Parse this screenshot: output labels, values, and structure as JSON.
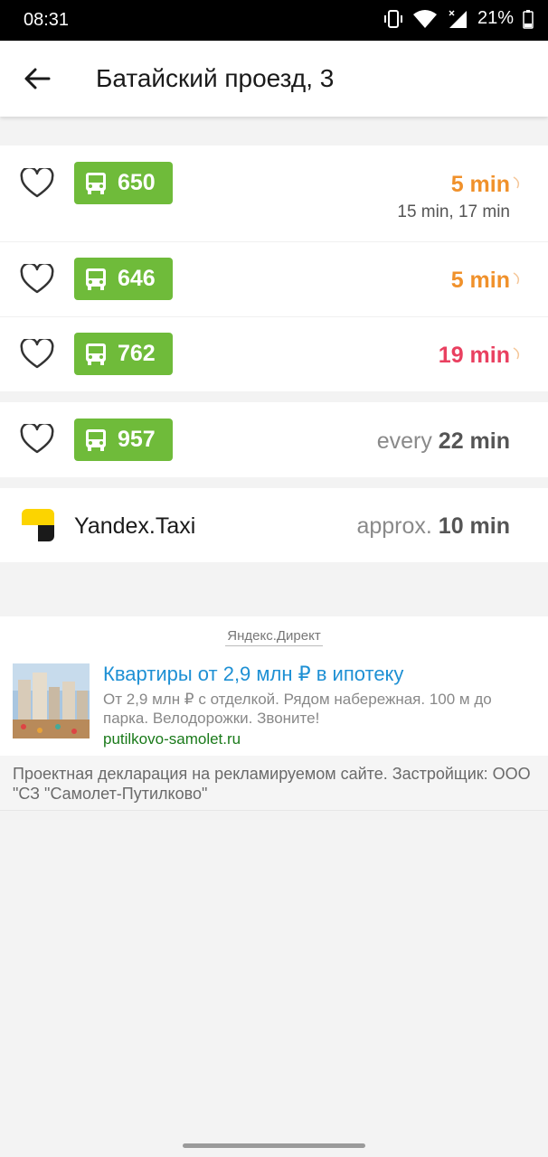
{
  "status_bar": {
    "time": "08:31",
    "battery_percent": "21%",
    "icons": [
      "vibrate-icon",
      "wifi-icon",
      "signal-icon",
      "battery-icon"
    ]
  },
  "header": {
    "title": "Батайский проезд, 3",
    "back_icon": "arrow-left-icon"
  },
  "routes": [
    {
      "number": "650",
      "eta": "5 min",
      "eta_color": "#f0912b",
      "next": "15 min, 17 min"
    },
    {
      "number": "646",
      "eta": "5 min",
      "eta_color": "#f0912b"
    },
    {
      "number": "762",
      "eta": "19 min",
      "eta_color": "#e94060"
    }
  ],
  "scheduled_route": {
    "number": "957",
    "prefix": "every",
    "interval": "22 min"
  },
  "taxi": {
    "label": "Yandex.Taxi",
    "prefix": "approx.",
    "time": "10 min"
  },
  "ad": {
    "source": "Яндекс.Директ",
    "title": "Квартиры от 2,9 млн ₽ в ипотеку",
    "text": "От 2,9 млн ₽ с отделкой. Рядом набережная. 100 м до парка. Велодорожки. Звоните!",
    "link": "putilkovo-samolet.ru",
    "disclaimer": "Проектная декларация на рекламируемом сайте. Застройщик: ООО \"СЗ \"Самолет-Путилково\""
  },
  "colors": {
    "route_badge": "#6fbb3a",
    "eta_orange": "#f0912b",
    "eta_red": "#e94060",
    "ad_title": "#1e90d4",
    "ad_link": "#1a7a1a"
  }
}
